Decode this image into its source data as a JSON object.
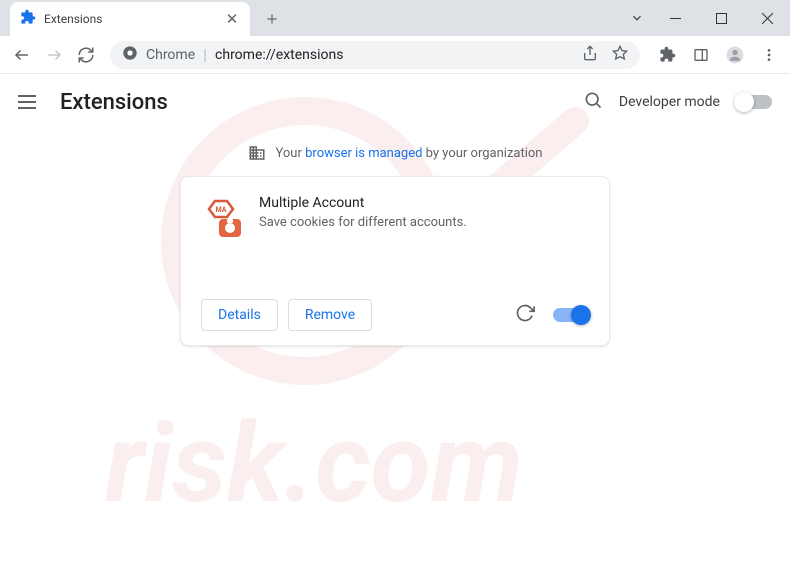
{
  "window": {
    "tab_title": "Extensions"
  },
  "toolbar": {
    "url_prefix": "Chrome",
    "url": "chrome://extensions"
  },
  "header": {
    "title": "Extensions",
    "dev_mode_label": "Developer mode",
    "dev_mode_on": false
  },
  "managed": {
    "prefix": "Your ",
    "link": "browser is managed",
    "suffix": " by your organization"
  },
  "extension": {
    "name": "Multiple Account",
    "description": "Save cookies for different accounts.",
    "details_label": "Details",
    "remove_label": "Remove",
    "enabled": true
  }
}
